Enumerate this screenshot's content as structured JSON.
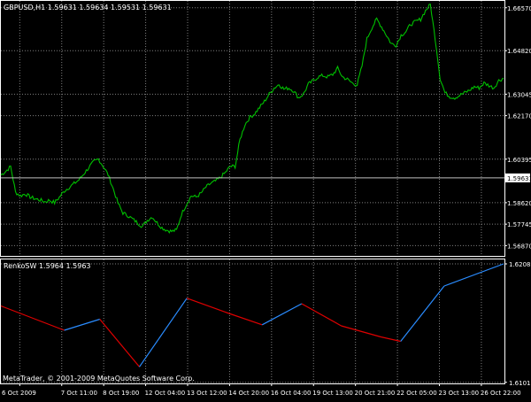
{
  "chart_data": [
    {
      "type": "line",
      "panel": "main",
      "header": "GBPUSD,H1  1.59631 1.59634 1.59531 1.59631",
      "series": [
        {
          "color": "#00c000",
          "values": [
            1.5975,
            1.599,
            1.601,
            1.5905,
            1.589,
            1.5898,
            1.5885,
            1.5878,
            1.5873,
            1.5866,
            1.5872,
            1.5862,
            1.5885,
            1.591,
            1.5925,
            1.594,
            1.5955,
            1.598,
            1.6005,
            1.6028,
            1.604,
            1.601,
            1.5975,
            1.592,
            1.586,
            1.582,
            1.581,
            1.5795,
            1.578,
            1.5765,
            1.579,
            1.5805,
            1.578,
            1.576,
            1.575,
            1.5745,
            1.575,
            1.5815,
            1.5855,
            1.589,
            1.5885,
            1.59,
            1.5925,
            1.594,
            1.595,
            1.5965,
            1.5985,
            1.601,
            1.601,
            1.612,
            1.618,
            1.621,
            1.6225,
            1.625,
            1.6275,
            1.6305,
            1.633,
            1.6345,
            1.6325,
            1.633,
            1.6318,
            1.629,
            1.6305,
            1.6345,
            1.636,
            1.6375,
            1.638,
            1.6375,
            1.6385,
            1.641,
            1.6375,
            1.6365,
            1.635,
            1.6342,
            1.642,
            1.653,
            1.6575,
            1.661,
            1.658,
            1.6545,
            1.651,
            1.6505,
            1.6545,
            1.656,
            1.659,
            1.66,
            1.661,
            1.6645,
            1.667,
            1.653,
            1.637,
            1.631,
            1.6295,
            1.629,
            1.63,
            1.631,
            1.632,
            1.6335,
            1.633,
            1.635,
            1.634,
            1.633,
            1.636,
            1.637
          ]
        }
      ],
      "ylim": [
        1.5645,
        1.6685
      ],
      "yticks": [
        "1.66570",
        "1.64820",
        "1.63045",
        "1.62170",
        "1.60395",
        "1.59631",
        "1.58620",
        "1.57745",
        "1.56870"
      ],
      "current_price": "1.59631",
      "current_price_value": 1.59631,
      "grid": true
    },
    {
      "type": "line",
      "panel": "indicator",
      "header": "RenkoSW 1.5964 1.5963",
      "series": [
        {
          "points": [
            [
              0,
              1.617
            ],
            [
              8,
              1.6148
            ],
            [
              12.5,
              1.6158
            ],
            [
              17.5,
              1.6115
            ],
            [
              23.5,
              1.6177
            ],
            [
              28.5,
              1.6164
            ],
            [
              33,
              1.6153
            ],
            [
              38,
              1.6172
            ],
            [
              43,
              1.6152
            ],
            [
              48,
              1.6142
            ],
            [
              50.5,
              1.6138
            ],
            [
              56,
              1.6188
            ],
            [
              63.5,
              1.6208
            ]
          ]
        }
      ],
      "rising_color": "#2a8cff",
      "falling_color": "#e00000",
      "ylim": [
        1.61,
        1.6212
      ],
      "yticks": [
        "1.6208",
        "1.6101"
      ],
      "grid": true
    }
  ],
  "xaxis": {
    "tick_labels": [
      "6 Oct 2009",
      "7 Oct 11:00",
      "8 Oct 19:00",
      "12 Oct 04:00",
      "13 Oct 12:00",
      "14 Oct 20:00",
      "16 Oct 04:00",
      "19 Oct 13:00",
      "20 Oct 21:00",
      "22 Oct 05:00",
      "23 Oct 13:00",
      "26 Oct 22:00"
    ]
  },
  "copyright": "MetaTrader, © 2001-2009 MetaQuotes Software Corp.",
  "colors": {
    "background": "#000000",
    "grid": "#7f7f7f",
    "text": "#ffffff",
    "price_line": "#c0c0c0"
  }
}
